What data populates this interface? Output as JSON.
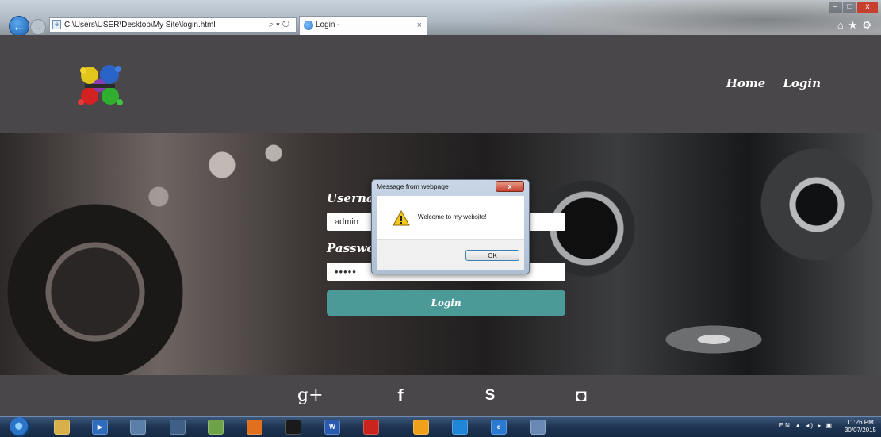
{
  "browser": {
    "address": "C:\\Users\\USER\\Desktop\\My Site\\login.html",
    "address_tools": "⌕ ▾ ↻",
    "tab_title": "Login -",
    "tab_close": "×",
    "win_min": "–",
    "win_max": "□",
    "win_close": "x",
    "icons": "⌂★⚙"
  },
  "header": {
    "nav": [
      {
        "label": "Home"
      },
      {
        "label": "Login"
      }
    ]
  },
  "form": {
    "username_label": "Username",
    "username_value": "admin",
    "password_label": "Password",
    "password_value": "•••••",
    "login_button": "Login"
  },
  "dialog": {
    "title": "Message from webpage",
    "message": "Welcome to my website!",
    "ok_label": "OK",
    "close_label": "x"
  },
  "footer": {
    "social": [
      {
        "name": "google-plus-icon",
        "glyph": "g+"
      },
      {
        "name": "facebook-icon",
        "glyph": "f"
      },
      {
        "name": "skype-icon",
        "glyph": "S"
      },
      {
        "name": "instagram-icon",
        "glyph": "◘"
      }
    ]
  },
  "taskbar": {
    "language": "EN",
    "time": "11:26 PM",
    "date": "30/07/2015"
  }
}
